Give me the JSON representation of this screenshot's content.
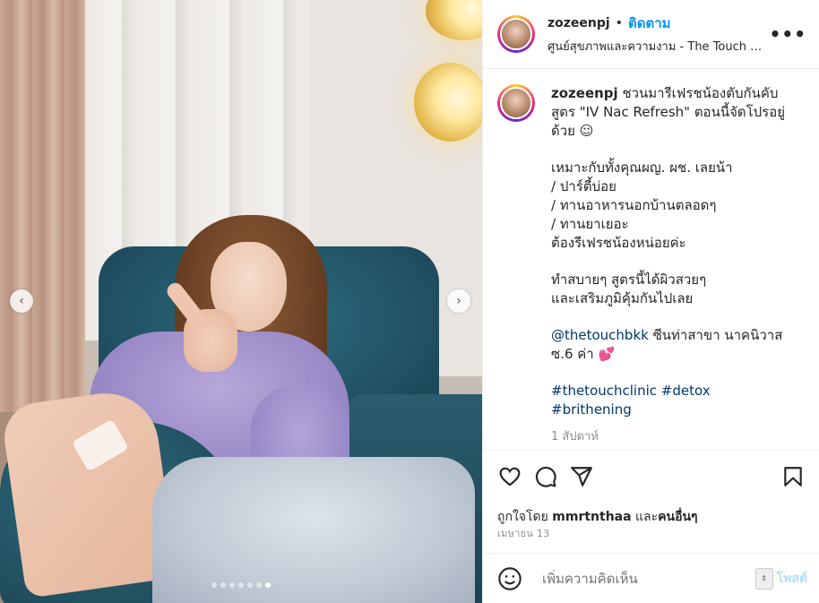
{
  "post": {
    "username": "zozeenpj",
    "bullet": "•",
    "follow_label": "ติดตาม",
    "location": "ศูนย์สุขภาพและความงาม - The Touch Clinic",
    "more_label": "•••",
    "caption": {
      "line1": " ชวนมารีเฟรชน้องตับกันคับ สูตร \"IV Nac Refresh\" ตอนนี้จัดโปรอยู่ด้วย ☺",
      "line2": "เหมาะกับทั้งคุณผญ. ผช. เลยน้า",
      "line3": "/ ปาร์ตี้บ่อย",
      "line4": "/ ทานอาหารนอกบ้านตลอดๆ",
      "line5": "/ ทานยาเยอะ",
      "line6": "ต้องรีเฟรชน้องหน่อยค่ะ",
      "line7": "ทำสบายๆ สูตรนี้ได้ผิวสวยๆ",
      "line8": "และเสริมภูมิคุ้มกันไปเลย",
      "mention": "@thetouchbkk",
      "mention_after": " ซีนท่าสาขา นาคนิวาส ซ.6 ค่า ",
      "heart": "💕",
      "hashtag1": "#thetouchclinic",
      "hashtag2": "#detox",
      "hashtag3": "#brithening",
      "time": "1 สัปดาห์"
    },
    "likes_prefix": "ถูกใจโดย ",
    "likes_user": "mmrtnthaa",
    "likes_mid": " และ",
    "likes_others": "คนอื่นๆ",
    "date": "เมษายน 13",
    "comment_placeholder": "เพิ่มความคิดเห็น",
    "post_label": "โพสต์"
  },
  "media": {
    "nav_prev": "‹",
    "nav_next": "›",
    "slides": 7,
    "active_slide": 6
  },
  "icons": [
    "heart-icon",
    "comment-icon",
    "share-icon",
    "bookmark-icon",
    "emoji-icon"
  ],
  "colors": {
    "link": "#00376b",
    "follow": "#0095f6",
    "muted": "#8e8e8e",
    "post_disabled": "#b2dffc"
  }
}
